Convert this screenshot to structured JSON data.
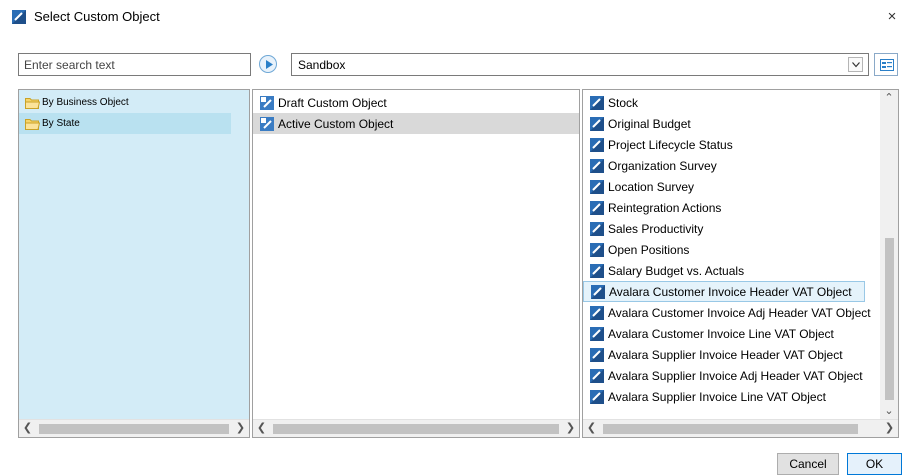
{
  "window": {
    "title": "Select Custom Object",
    "close_label": "×"
  },
  "search": {
    "placeholder": "Enter search text",
    "value": ""
  },
  "solution_select": {
    "value": "Sandbox"
  },
  "left_tree": {
    "items": [
      {
        "label": "By Business Object",
        "icon": "folder-icon",
        "selected": false
      },
      {
        "label": "By State",
        "icon": "folder-icon",
        "selected": true
      }
    ]
  },
  "middle_list": {
    "items": [
      {
        "label": "Draft Custom Object",
        "icon": "custom-object-icon",
        "selected": false
      },
      {
        "label": "Active Custom Object",
        "icon": "custom-object-icon",
        "selected": true
      }
    ]
  },
  "right_list": {
    "items": [
      {
        "label": "Stock"
      },
      {
        "label": "Original Budget"
      },
      {
        "label": "Project Lifecycle Status"
      },
      {
        "label": "Organization Survey"
      },
      {
        "label": "Location Survey"
      },
      {
        "label": "Reintegration Actions"
      },
      {
        "label": "Sales Productivity"
      },
      {
        "label": "Open Positions"
      },
      {
        "label": "Salary Budget vs. Actuals"
      },
      {
        "label": "Avalara Customer Invoice Header VAT Object",
        "highlighted": true
      },
      {
        "label": "Avalara Customer Invoice Adj Header VAT Object"
      },
      {
        "label": "Avalara Customer Invoice Line VAT Object"
      },
      {
        "label": "Avalara Supplier Invoice Header VAT Object"
      },
      {
        "label": "Avalara Supplier Invoice Adj Header VAT Object"
      },
      {
        "label": "Avalara Supplier Invoice Line VAT Object"
      }
    ]
  },
  "buttons": {
    "cancel": "Cancel",
    "ok": "OK"
  },
  "colors": {
    "tree_bg": "#d3ecf7",
    "tree_selected": "#b9e1f0",
    "list_selected": "#d9d9d9",
    "highlight_bg": "#e5f3fb",
    "accent": "#0078d7"
  }
}
